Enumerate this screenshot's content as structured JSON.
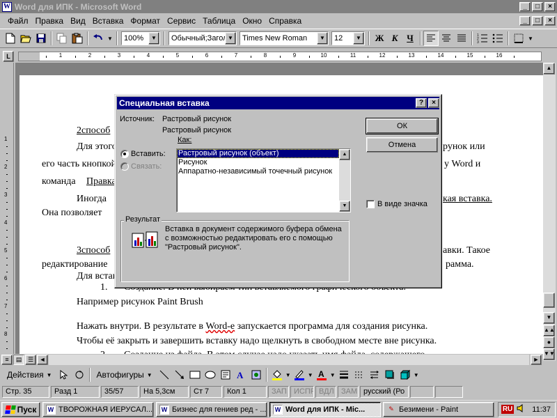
{
  "window": {
    "title": "Word для   ИПК - Microsoft Word",
    "app_icon": "W",
    "min_glyph": "_",
    "max_glyph": "□",
    "close_glyph": "×"
  },
  "menu": {
    "items": [
      {
        "label": "Файл"
      },
      {
        "label": "Правка"
      },
      {
        "label": "Вид"
      },
      {
        "label": "Вставка"
      },
      {
        "label": "Формат"
      },
      {
        "label": "Сервис"
      },
      {
        "label": "Таблица"
      },
      {
        "label": "Окно"
      },
      {
        "label": "Справка"
      }
    ]
  },
  "toolbar": {
    "zoom": "100%",
    "style": "Обычный;Загол",
    "font": "Times New Roman",
    "size": "12",
    "bold": "Ж",
    "italic": "К",
    "underline": "Ч"
  },
  "ruler": {
    "marks": [
      "1",
      "2",
      "3",
      "4",
      "5",
      "6",
      "7",
      "8",
      "9",
      "10",
      "11",
      "12",
      "13",
      "14",
      "15",
      "16"
    ],
    "tab_glyph": "L"
  },
  "vruler": {
    "marks": [
      "1",
      "2",
      "3",
      "4",
      "5",
      "6",
      "7",
      "8"
    ]
  },
  "document": {
    "l1": "2способ",
    "l2a": "Для этого",
    "l2b": "рунок или",
    "l3a": "его часть кнопкой",
    "l3b": "у Word и",
    "l4a": "команда",
    "l4b": "Правка",
    "l5a": "Иногда",
    "l5b": "кая вставка.",
    "l6a": "Она позволяет",
    "l7a": "3способ",
    "l7b": "авки.   Такое",
    "l8a": "редактирование",
    "l8b": "рамма.",
    "l9a": "Для вставки",
    "l10a": "1.",
    "l10b": "Создание. В ней выбираем тип вставляемого графического объекта.",
    "l11": "Например рисунок  Paint Brush",
    "l12a": "Нажать внутри. В результате в ",
    "l12b": "Word-е",
    "l12c": " запускается программа для создания рисунка.",
    "l13": "Чтобы её закрыть и завершить вставку надо щелкнуть в свободном месте вне рисунка.",
    "l14a": "2.",
    "l14b": "Создание из файла. В этом случае надо указать имя файла, содержащего"
  },
  "dialog": {
    "title": "Специальная вставка",
    "help_glyph": "?",
    "source_label": "Источник:",
    "source_value_1": "Растровый рисунок",
    "source_value_2": "Растровый рисунок",
    "as_label": "Как:",
    "paste_label": "Вставить:",
    "link_label": "Связать:",
    "list_items": [
      "Растровый рисунок (объект)",
      "Рисунок",
      "Аппаратно-независимый точечный рисунок"
    ],
    "ok_label": "ОК",
    "cancel_label": "Отмена",
    "icon_checkbox_label": "В виде значка",
    "result_legend": "Результат",
    "result_text": "Вставка в документ содержимого буфера обмена с возможностью редактировать его с помощью \"Растровый рисунок\".",
    "scroll_up": "▲",
    "scroll_down": "▼"
  },
  "drawbar": {
    "actions_label": "Действия",
    "autoshapes_label": "Автофигуры"
  },
  "status": {
    "page": "Стр.  35",
    "section": "Разд  1",
    "pages": "35/57",
    "at": "На  5,3см",
    "line": "Ст  7",
    "col": "Кол  1",
    "rec": "ЗАП",
    "trk": "ИСПР",
    "ext": "ВДЛ",
    "ovr": "ЗАМ",
    "lang": "русский (Ро"
  },
  "taskbar": {
    "start": "Пуск",
    "tasks": [
      {
        "label": "ТВОРОЖНАЯ ИЕРУСАЛ...",
        "icon": "W"
      },
      {
        "label": "Бизнес для гениев ред - ...",
        "icon": "W"
      },
      {
        "label": "Word для   ИПК - Mic...",
        "icon": "W"
      },
      {
        "label": "Безимени - Paint",
        "icon": "✎"
      }
    ],
    "lang": "RU",
    "clock": "11:37"
  },
  "colors": {
    "titlebar_active": "#000080",
    "titlebar_inactive": "#808080",
    "face": "#c0c0c0"
  }
}
